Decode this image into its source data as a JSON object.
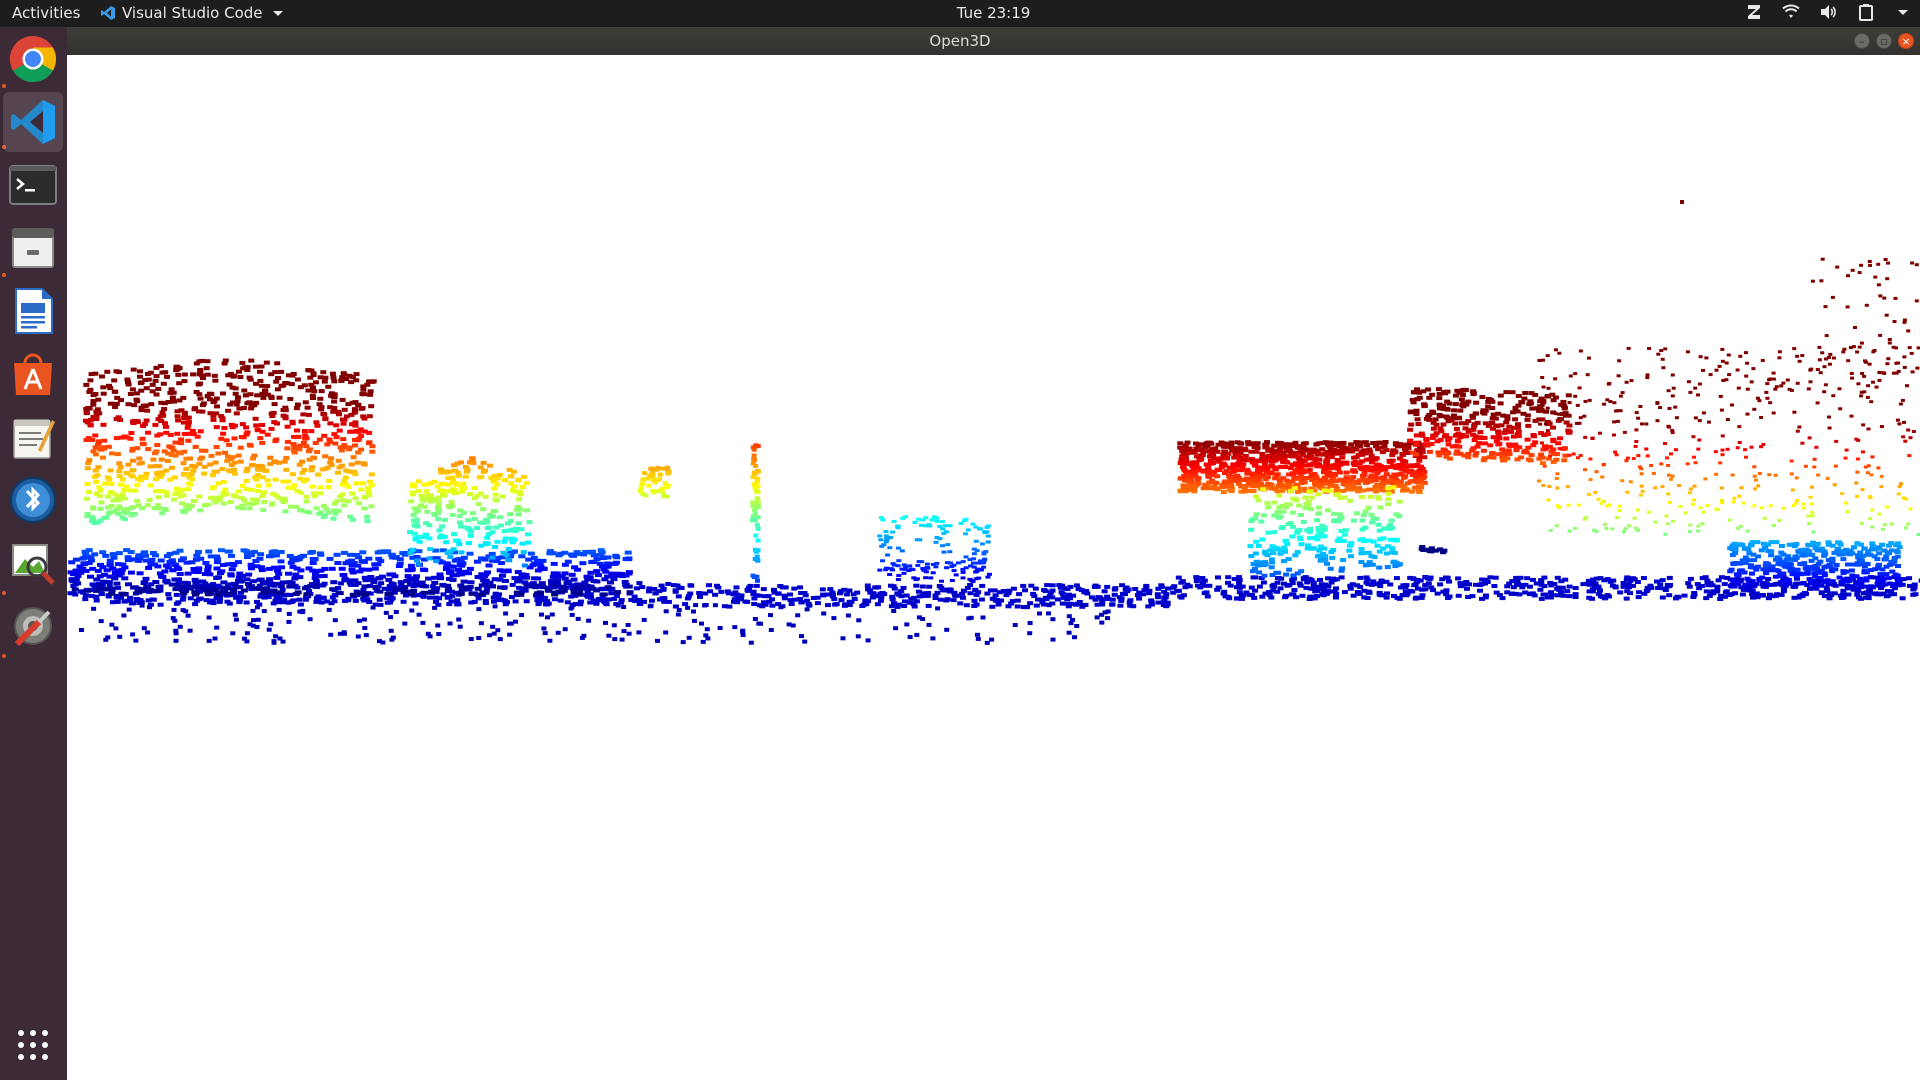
{
  "topbar": {
    "activities_label": "Activities",
    "app_menu_label": "Visual Studio Code",
    "clock": "Tue 23:19"
  },
  "window": {
    "title": "Open3D"
  },
  "dock": {
    "items": [
      {
        "name": "chrome-icon",
        "running": true,
        "active": false
      },
      {
        "name": "vscode-icon",
        "running": true,
        "active": true
      },
      {
        "name": "terminal-icon",
        "running": false,
        "active": false
      },
      {
        "name": "file-manager-icon",
        "running": true,
        "active": false
      },
      {
        "name": "writer-icon",
        "running": false,
        "active": false
      },
      {
        "name": "software-center-icon",
        "running": false,
        "active": false
      },
      {
        "name": "text-editor-icon",
        "running": false,
        "active": false
      },
      {
        "name": "bluetooth-app-icon",
        "running": false,
        "active": false
      },
      {
        "name": "image-viewer-icon",
        "running": true,
        "active": false
      },
      {
        "name": "system-tools-icon",
        "running": true,
        "active": false
      }
    ],
    "show_apps_icon": "grid-icon"
  },
  "colors": {
    "topbar_bg": "#1d1d1d",
    "dock_bg": "#3c2a36",
    "accent": "#e95420",
    "titlebar_bg": "#3a3935"
  },
  "viewer": {
    "content": "lidar-point-cloud",
    "colormap": "jet"
  }
}
